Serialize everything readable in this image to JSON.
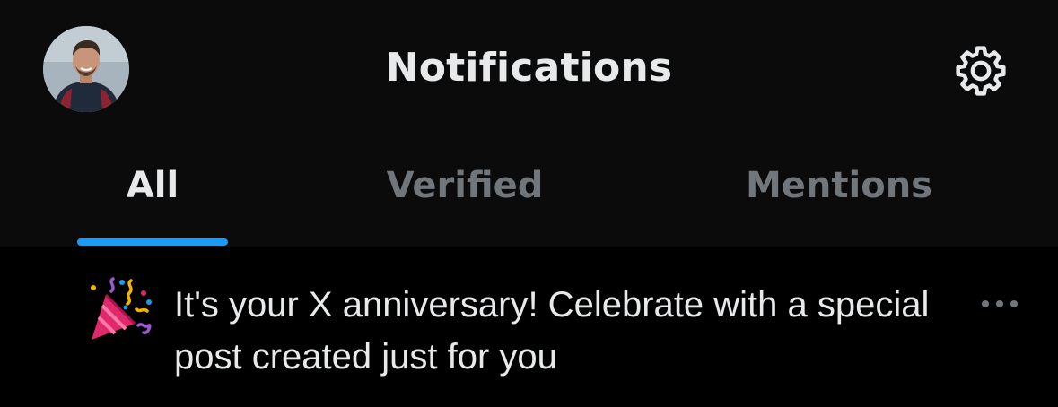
{
  "header": {
    "title": "Notifications",
    "avatar_icon": "user-avatar",
    "settings_icon": "gear-icon"
  },
  "tabs": [
    {
      "label": "All",
      "active": true
    },
    {
      "label": "Verified",
      "active": false
    },
    {
      "label": "Mentions",
      "active": false
    }
  ],
  "notifications": [
    {
      "icon": "party-popper-icon",
      "text": "It's your X anniversary! Celebrate with a special post created just for you",
      "more_icon": "more-horizontal-icon"
    }
  ],
  "colors": {
    "background": "#000000",
    "header_background": "#0b0b0c",
    "text_primary": "#e7e9ea",
    "text_secondary": "#71767b",
    "accent": "#1d9bf0",
    "divider": "#2f3336"
  }
}
